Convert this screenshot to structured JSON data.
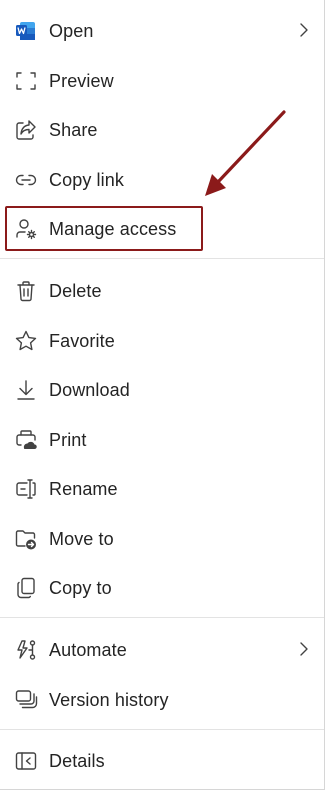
{
  "menu": {
    "items": [
      {
        "label": "Open",
        "icon": "word-icon"
      },
      {
        "label": "Preview",
        "icon": "preview-icon"
      },
      {
        "label": "Share",
        "icon": "share-icon"
      },
      {
        "label": "Copy link",
        "icon": "link-icon"
      },
      {
        "label": "Manage access",
        "icon": "manage-access-icon"
      },
      {
        "label": "Delete",
        "icon": "trash-icon"
      },
      {
        "label": "Favorite",
        "icon": "star-icon"
      },
      {
        "label": "Download",
        "icon": "download-icon"
      },
      {
        "label": "Print",
        "icon": "print-icon"
      },
      {
        "label": "Rename",
        "icon": "rename-icon"
      },
      {
        "label": "Move to",
        "icon": "move-to-icon"
      },
      {
        "label": "Copy to",
        "icon": "copy-icon"
      },
      {
        "label": "Automate",
        "icon": "automate-icon"
      },
      {
        "label": "Version history",
        "icon": "version-history-icon"
      },
      {
        "label": "Details",
        "icon": "details-icon"
      }
    ],
    "submenu_chevron": "chevron-right-icon"
  },
  "annotation": {
    "highlight_color": "#8b1a1a",
    "target": "Manage access"
  },
  "colors": {
    "text": "#242424",
    "icon": "#424242",
    "word_blue": "#185abd",
    "divider": "#e3e3e3"
  }
}
